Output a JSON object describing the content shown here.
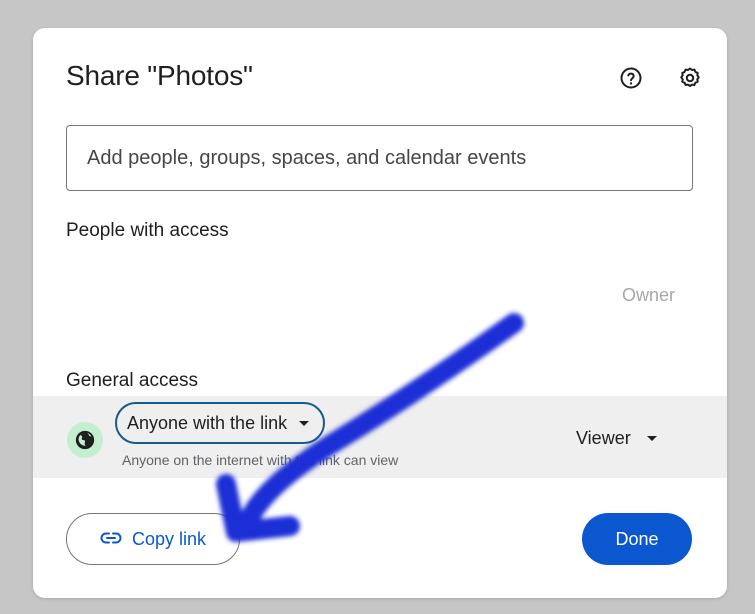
{
  "dialog": {
    "title": "Share \"Photos\"",
    "icons": {
      "help": "help-circle-icon",
      "settings": "gear-icon"
    }
  },
  "share_input": {
    "placeholder": "Add people, groups, spaces, and calendar events",
    "value": ""
  },
  "people_with_access": {
    "heading": "People with access",
    "rows": [
      {
        "role": "Owner"
      }
    ]
  },
  "general_access": {
    "heading": "General access",
    "icon": "globe-icon",
    "selected": "Anyone with the link",
    "description": "Anyone on the internet with the link can view",
    "role": "Viewer"
  },
  "footer": {
    "copy_link_label": "Copy link",
    "copy_link_icon": "link-icon",
    "done_label": "Done"
  },
  "colors": {
    "accent": "#0b57d0",
    "annotation_arrow": "#1f2fd6",
    "globe_badge": "#c4eed0",
    "highlight_row": "#efefef"
  }
}
